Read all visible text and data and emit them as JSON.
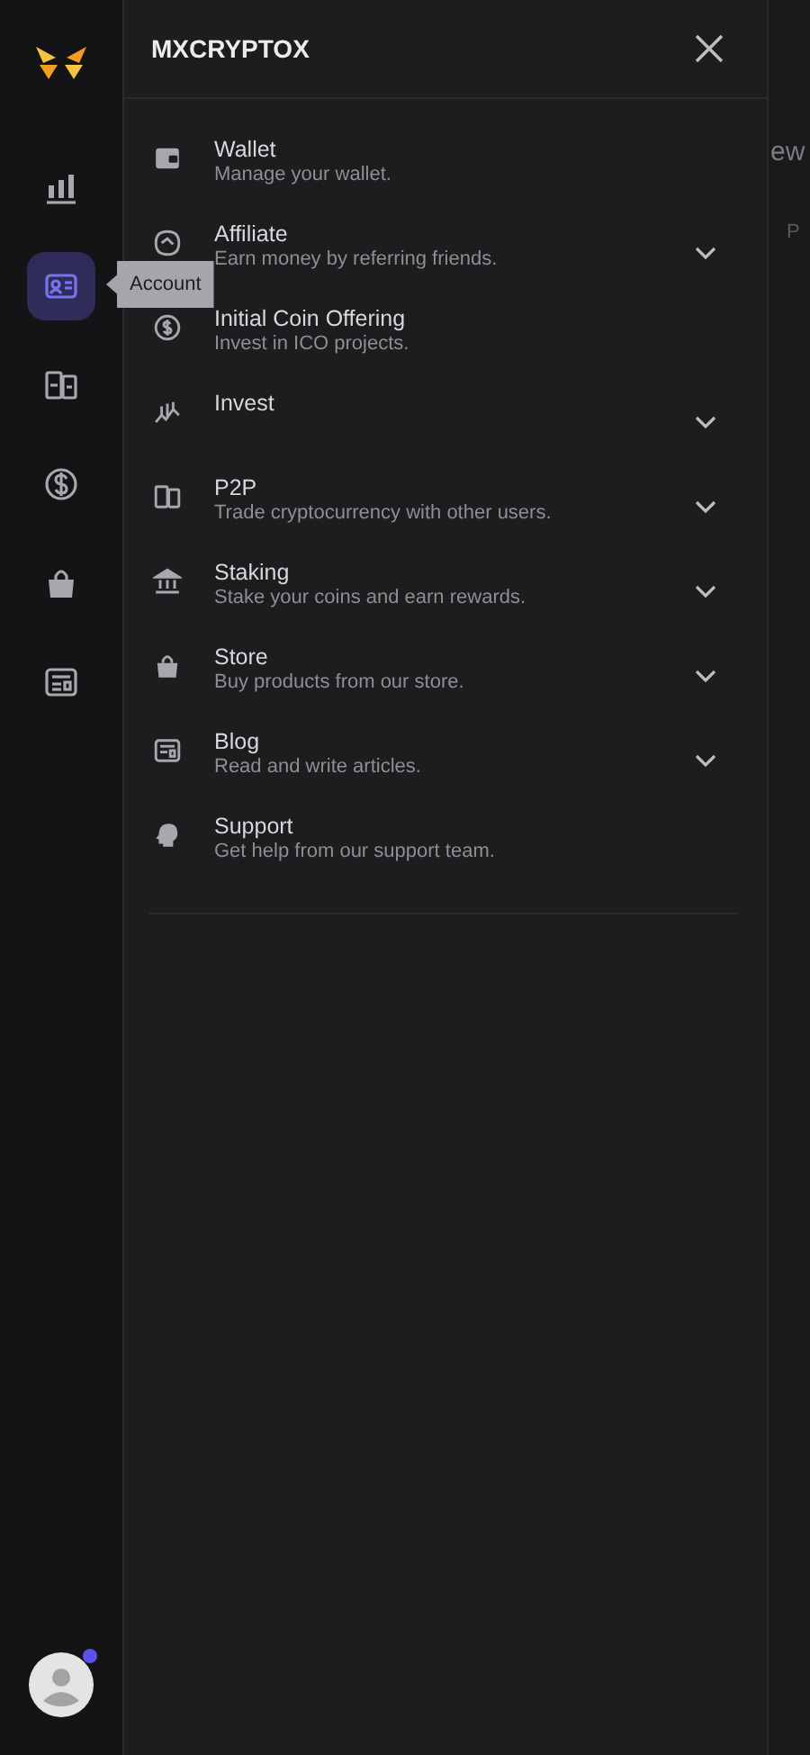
{
  "rail": {
    "items": [
      {
        "selected": false
      },
      {
        "selected": true,
        "tooltip": "Account"
      },
      {
        "selected": false
      },
      {
        "selected": false
      },
      {
        "selected": false
      },
      {
        "selected": false
      }
    ],
    "avatar": {
      "notification": true
    }
  },
  "panel": {
    "title": "MXCRYPTOX",
    "items": [
      {
        "title": "Wallet",
        "subtitle": "Manage your wallet.",
        "expandable": false
      },
      {
        "title": "Affiliate",
        "subtitle": "Earn money by referring friends.",
        "expandable": true
      },
      {
        "title": "Initial Coin Offering",
        "subtitle": "Invest in ICO projects.",
        "expandable": false
      },
      {
        "title": "Invest",
        "expandable": true
      },
      {
        "title": "P2P",
        "subtitle": "Trade cryptocurrency with other users.",
        "expandable": true
      },
      {
        "title": "Staking",
        "subtitle": "Stake your coins and earn rewards.",
        "expandable": true
      },
      {
        "title": "Store",
        "subtitle": "Buy products from our store.",
        "expandable": true
      },
      {
        "title": "Blog",
        "subtitle": "Read and write articles.",
        "expandable": true
      },
      {
        "title": "Support",
        "subtitle": "Get help from our support team.",
        "expandable": false
      }
    ]
  },
  "backdrop": {
    "heading": "ew",
    "label": "P"
  }
}
